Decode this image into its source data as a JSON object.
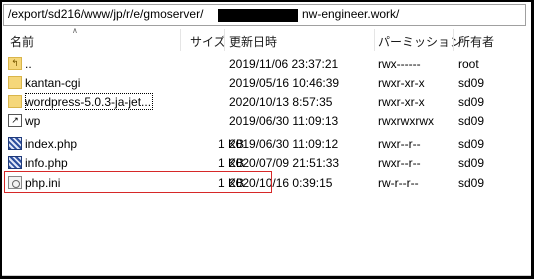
{
  "path": {
    "prefix": "/export/sd216/www/jp/r/e/gmoserver/",
    "suffix": "nw-engineer.work/"
  },
  "columns": {
    "name": "名前",
    "size": "サイズ",
    "modified": "更新日時",
    "permission": "パーミッション",
    "owner": "所有者"
  },
  "rows": [
    {
      "name": "..",
      "size": "",
      "modified": "2019/11/06 23:37:21",
      "permission": "rwx------",
      "owner": "root",
      "icon": "folder-up-icon"
    },
    {
      "name": "kantan-cgi",
      "size": "",
      "modified": "2019/05/16 10:46:39",
      "permission": "rwxr-xr-x",
      "owner": "sd09",
      "icon": "folder-icon"
    },
    {
      "name": "wordpress-5.0.3-ja-jet...",
      "size": "",
      "modified": "2020/10/13 8:57:35",
      "permission": "rwxr-xr-x",
      "owner": "sd09",
      "icon": "folder-icon"
    },
    {
      "name": "wp",
      "size": "",
      "modified": "2019/06/30 11:09:13",
      "permission": "rwxrwxrwx",
      "owner": "sd09",
      "icon": "shortcut-icon"
    },
    {
      "name": "index.php",
      "size": "1 KB",
      "modified": "2019/06/30 11:09:12",
      "permission": "rwxr--r--",
      "owner": "sd09",
      "icon": "php-file-icon"
    },
    {
      "name": "info.php",
      "size": "1 KB",
      "modified": "2020/07/09 21:51:33",
      "permission": "rwxr--r--",
      "owner": "sd09",
      "icon": "php-file-icon"
    },
    {
      "name": "php.ini",
      "size": "1 KB",
      "modified": "2020/10/16 0:39:15",
      "permission": "rw-r--r--",
      "owner": "sd09",
      "icon": "settings-file-icon"
    }
  ],
  "highlight_color": "#d62828"
}
